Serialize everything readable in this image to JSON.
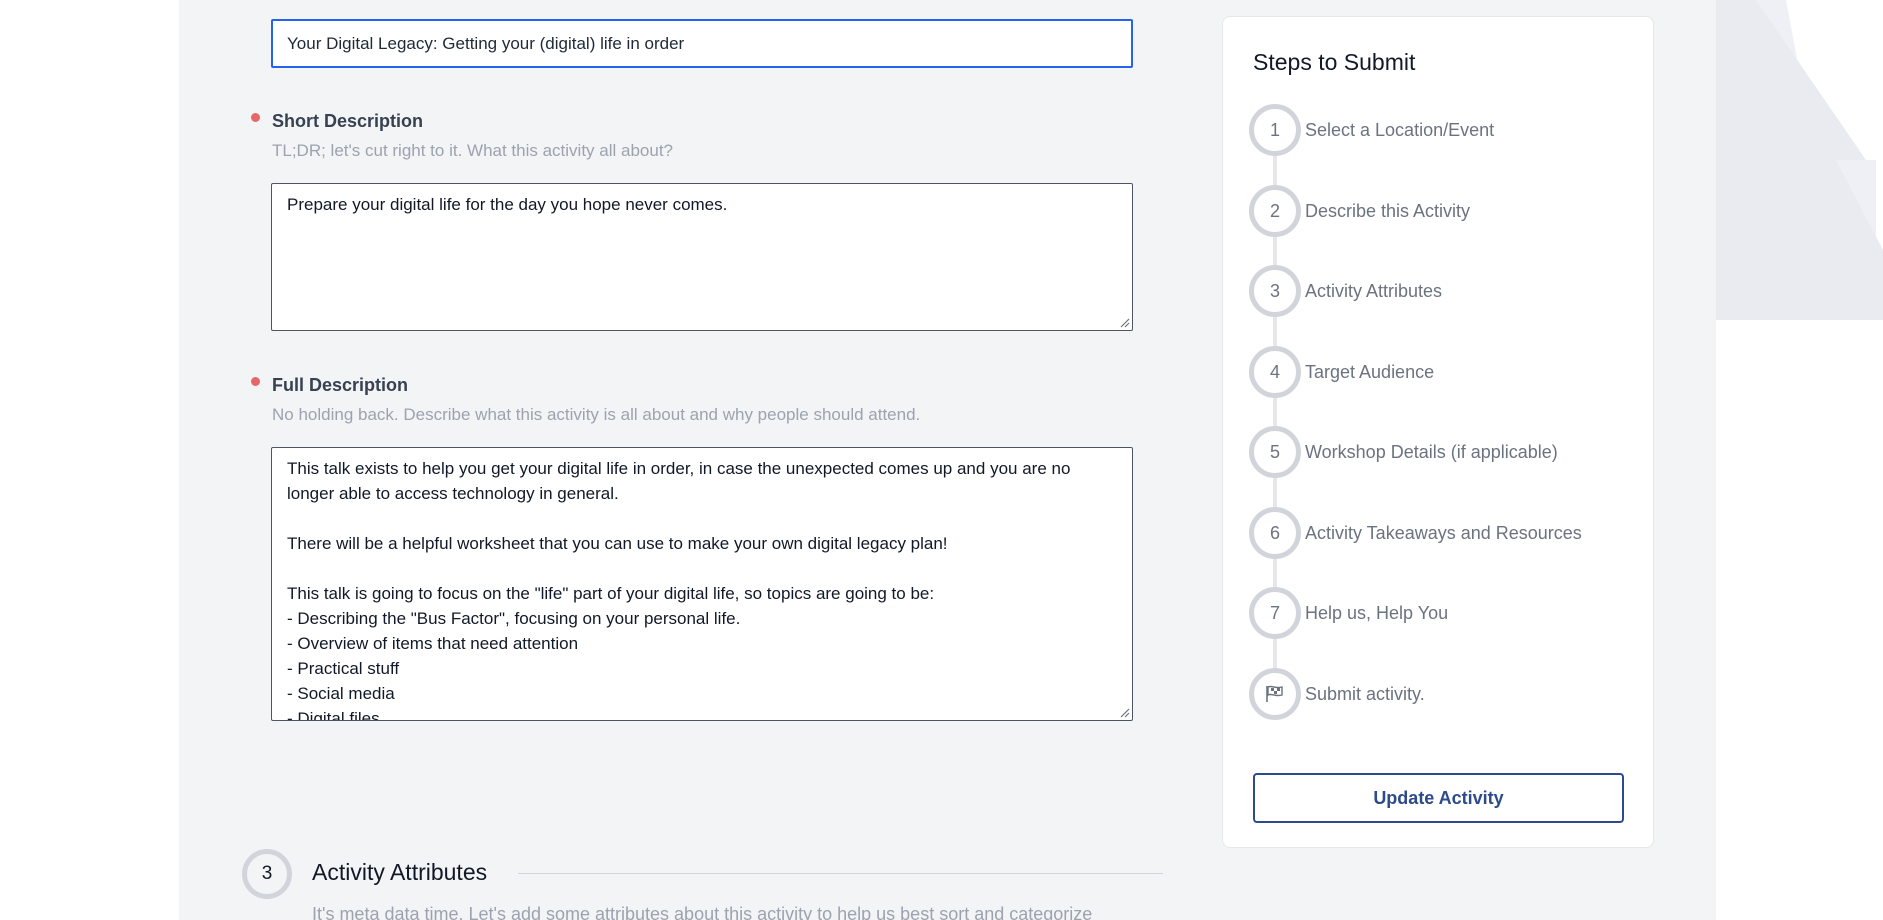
{
  "form": {
    "title_value": "Your Digital Legacy: Getting your (digital) life in order",
    "short_description": {
      "label": "Short Description",
      "hint": "TL;DR; let's cut right to it. What this activity all about?",
      "value": "Prepare your digital life for the day you hope never comes."
    },
    "full_description": {
      "label": "Full Description",
      "hint": "No holding back. Describe what this activity is all about and why people should attend.",
      "value": "This talk exists to help you get your digital life in order, in case the unexpected comes up and you are no longer able to access technology in general.\n\nThere will be a helpful worksheet that you can use to make your own digital legacy plan!\n\nThis talk is going to focus on the \"life\" part of your digital life, so topics are going to be:\n- Describing the \"Bus Factor\", focusing on your personal life.\n- Overview of items that need attention\n- Practical stuff\n- Social media\n- Digital files"
    }
  },
  "section": {
    "number": "3",
    "title": "Activity Attributes",
    "description": "It's meta data time. Let's add some attributes about this activity to help us best sort and categorize"
  },
  "steps_panel": {
    "title": "Steps to Submit",
    "steps": [
      {
        "number": "1",
        "label": "Select a Location/Event"
      },
      {
        "number": "2",
        "label": "Describe this Activity"
      },
      {
        "number": "3",
        "label": "Activity Attributes"
      },
      {
        "number": "4",
        "label": "Target Audience"
      },
      {
        "number": "5",
        "label": "Workshop Details (if applicable)"
      },
      {
        "number": "6",
        "label": "Activity Takeaways and Resources"
      },
      {
        "number": "7",
        "label": "Help us, Help You"
      },
      {
        "number": "",
        "icon": "flag-icon",
        "label": "Submit activity."
      }
    ],
    "update_button": "Update Activity"
  },
  "colors": {
    "accent": "#2563eb",
    "required_dot": "#e5666b",
    "button_border": "#2d4a8a"
  }
}
